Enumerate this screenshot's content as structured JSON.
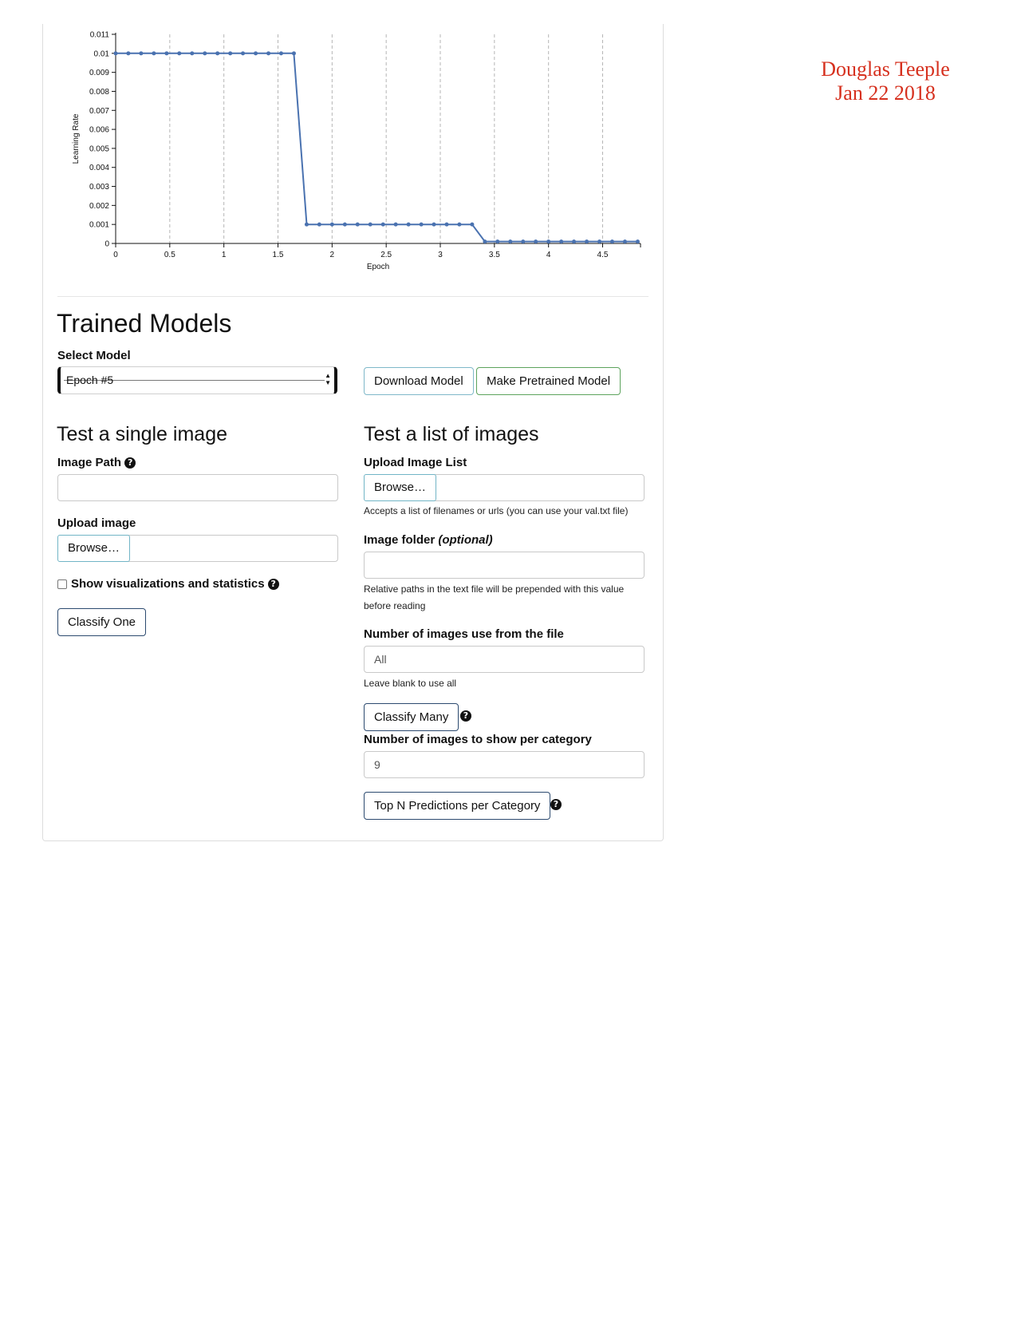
{
  "signature": {
    "name": "Douglas Teeple",
    "date": "Jan 22 2018"
  },
  "chart_data": {
    "type": "line",
    "xlabel": "Epoch",
    "ylabel": "Learning Rate",
    "xlim": [
      0,
      4.85
    ],
    "ylim": [
      0,
      0.011
    ],
    "x_ticks": [
      "0",
      "0.5",
      "1",
      "1.5",
      "2",
      "2.5",
      "3",
      "3.5",
      "4",
      "4.5"
    ],
    "y_ticks": [
      "0",
      "0.001",
      "0.002",
      "0.003",
      "0.004",
      "0.005",
      "0.006",
      "0.007",
      "0.008",
      "0.009",
      "0.01",
      "0.011"
    ],
    "grid": "vertical dashed",
    "color": "#4a72b0",
    "x": [
      0.0,
      0.117,
      0.235,
      0.353,
      0.471,
      0.588,
      0.706,
      0.824,
      0.941,
      1.059,
      1.176,
      1.294,
      1.412,
      1.529,
      1.647,
      1.765,
      1.882,
      2.0,
      2.118,
      2.235,
      2.353,
      2.471,
      2.588,
      2.706,
      2.824,
      2.941,
      3.059,
      3.176,
      3.294,
      3.412,
      3.529,
      3.647,
      3.765,
      3.882,
      4.0,
      4.118,
      4.235,
      4.353,
      4.471,
      4.588,
      4.706,
      4.824
    ],
    "y": [
      0.01,
      0.01,
      0.01,
      0.01,
      0.01,
      0.01,
      0.01,
      0.01,
      0.01,
      0.01,
      0.01,
      0.01,
      0.01,
      0.01,
      0.01,
      0.001,
      0.001,
      0.001,
      0.001,
      0.001,
      0.001,
      0.001,
      0.001,
      0.001,
      0.001,
      0.001,
      0.001,
      0.001,
      0.001,
      0.0001,
      0.0001,
      0.0001,
      0.0001,
      0.0001,
      0.0001,
      0.0001,
      0.0001,
      0.0001,
      0.0001,
      0.0001,
      0.0001,
      0.0001
    ]
  },
  "trained_models": {
    "title": "Trained Models",
    "select_label": "Select Model",
    "selected_model": "Epoch #5",
    "download_button": "Download Model",
    "pretrained_button": "Make Pretrained Model"
  },
  "single": {
    "title": "Test a single image",
    "image_path_label": "Image Path",
    "image_path_value": "",
    "upload_label": "Upload image",
    "browse": "Browse…",
    "show_vis_label": "Show visualizations and statistics",
    "show_vis_checked": false,
    "classify_button": "Classify One"
  },
  "list": {
    "title": "Test a list of images",
    "upload_label": "Upload Image List",
    "browse": "Browse…",
    "upload_help": "Accepts a list of filenames or urls (you can use your val.txt file)",
    "folder_label": "Image folder",
    "folder_optional": "(optional)",
    "folder_value": "",
    "folder_help_1": "Relative paths in the text file will be prepended with this value",
    "folder_help_2": "before reading",
    "num_label": "Number of images use from the file",
    "num_placeholder": "All",
    "num_help": "Leave blank to use all",
    "classify_many_button": "Classify Many",
    "per_category_label": "Number of images to show per category",
    "per_category_value": "9",
    "top_n_button": "Top N Predictions per Category"
  },
  "help_icon": "question-circle-icon"
}
